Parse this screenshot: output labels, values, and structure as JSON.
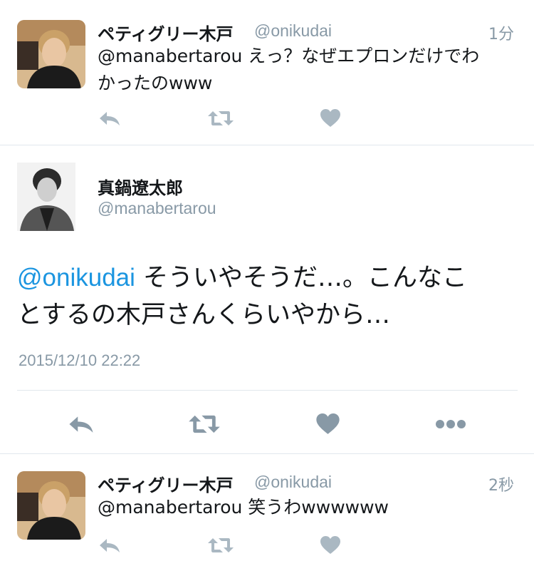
{
  "tweets": [
    {
      "name": "ペティグリー木戸",
      "handle": "@onikudai",
      "time": "1分",
      "mention": "@manabertarou",
      "text_line1": " えっ？なぜエプロンだけでわ",
      "text_line2": "かったのwww"
    },
    {
      "name": "真鍋遼太郎",
      "handle": "@manabertarou",
      "mention": "@onikudai",
      "text_line1": " そういやそうだ…。こんなこ",
      "text_line2": "とするの木戸さんくらいやから…",
      "date": "2015/12/10 22:22"
    },
    {
      "name": "ペティグリー木戸",
      "handle": "@onikudai",
      "time": "2秒",
      "mention": "@manabertarou",
      "text_line1": " 笑うわwwwwww"
    }
  ],
  "icons": {
    "reply": "reply-icon",
    "retweet": "retweet-icon",
    "like": "heart-icon",
    "more": "more-icon"
  },
  "colors": {
    "mention": "#1b95e0",
    "secondary_text": "#8899a6",
    "icon_gray": "#aab8c2",
    "separator": "#e1e8ed"
  }
}
